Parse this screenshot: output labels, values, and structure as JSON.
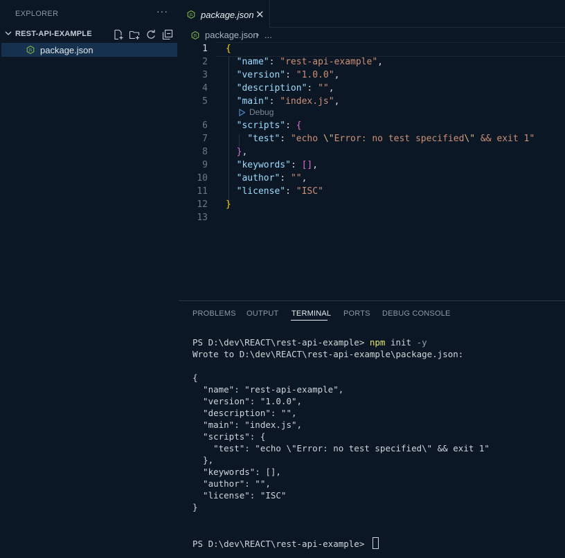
{
  "sidebar": {
    "header": "EXPLORER",
    "more_icon": "ellipsis-icon",
    "folder": "REST-API-EXAMPLE",
    "actions": [
      "new-file-icon",
      "new-folder-icon",
      "refresh-icon",
      "collapse-all-icon"
    ],
    "file": "package.json"
  },
  "editor": {
    "tab": {
      "label": "package.json",
      "close": "✕"
    },
    "breadcrumb": {
      "file": "package.json",
      "sep": "›",
      "more": "..."
    },
    "codelens": "Debug",
    "line_numbers": [
      "1",
      "2",
      "3",
      "4",
      "5",
      "6",
      "7",
      "8",
      "9",
      "10",
      "11",
      "12",
      "13"
    ],
    "code": {
      "l1_open": "{",
      "l2_key": "\"name\"",
      "l2_val": "\"rest-api-example\"",
      "l3_key": "\"version\"",
      "l3_val": "\"1.0.0\"",
      "l4_key": "\"description\"",
      "l4_val": "\"\"",
      "l5_key": "\"main\"",
      "l5_val": "\"index.js\"",
      "l6_key": "\"scripts\"",
      "l6_open": "{",
      "l7_key": "\"test\"",
      "l7_v1": "\"echo ",
      "l7_esc1": "\\\"",
      "l7_v2": "Error: no test specified",
      "l7_esc2": "\\\"",
      "l7_v3": " && exit 1\"",
      "l8_close": "}",
      "l9_key": "\"keywords\"",
      "l9_val": "[]",
      "l10_key": "\"author\"",
      "l10_val": "\"\"",
      "l11_key": "\"license\"",
      "l11_val": "\"ISC\"",
      "l12_close": "}"
    }
  },
  "panel": {
    "tabs": [
      "PROBLEMS",
      "OUTPUT",
      "TERMINAL",
      "PORTS",
      "DEBUG CONSOLE"
    ],
    "active_tab": "TERMINAL",
    "terminal": {
      "prompt": "PS D:\\dev\\REACT\\rest-api-example> ",
      "cmd_npm": "npm",
      "cmd_init": " init ",
      "cmd_flag": "-y",
      "lines": [
        "Wrote to D:\\dev\\REACT\\rest-api-example\\package.json:",
        "",
        "{",
        "  \"name\": \"rest-api-example\",",
        "  \"version\": \"1.0.0\",",
        "  \"description\": \"\",",
        "  \"main\": \"index.js\",",
        "  \"scripts\": {",
        "    \"test\": \"echo \\\"Error: no test specified\\\" && exit 1\"",
        "  },",
        "  \"keywords\": [],",
        "  \"author\": \"\",",
        "  \"license\": \"ISC\"",
        "}"
      ],
      "final_prompt": "PS D:\\dev\\REACT\\rest-api-example> "
    }
  },
  "colors": {
    "background": "#0b1724",
    "selected_file": "#16314d",
    "json_key": "#9cdcfe",
    "json_string": "#ce9178",
    "bracket_gold": "#ffd700",
    "bracket_purple": "#da70d6",
    "js_badge": "#8bc34a"
  }
}
